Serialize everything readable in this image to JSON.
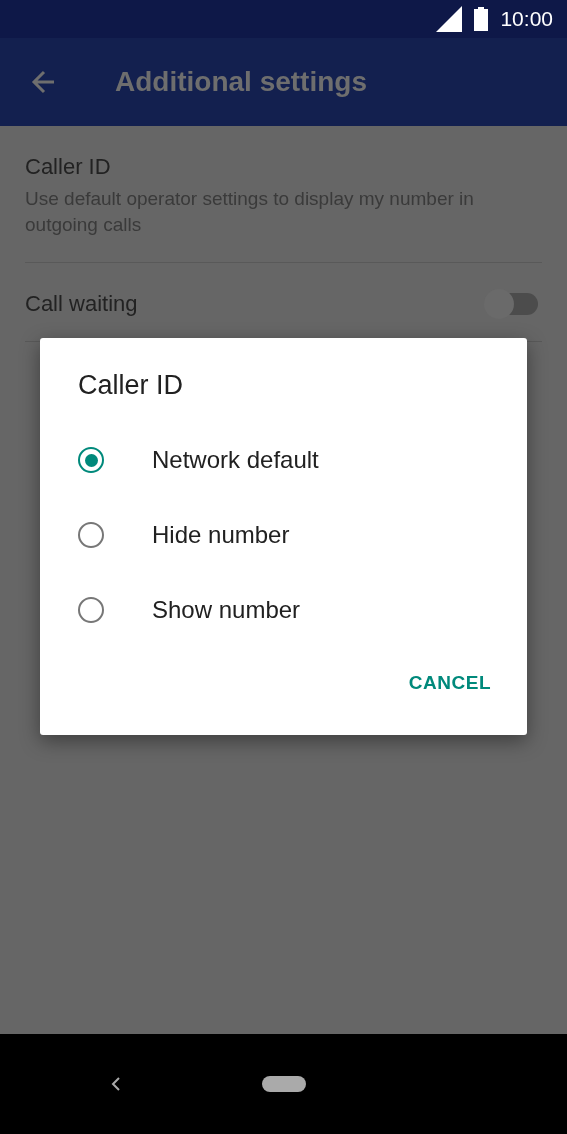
{
  "status_bar": {
    "time": "10:00"
  },
  "app_bar": {
    "title": "Additional settings"
  },
  "settings": [
    {
      "title": "Caller ID",
      "subtitle": "Use default operator settings to display my number in outgoing calls",
      "kind": "text"
    },
    {
      "title": "Call waiting",
      "kind": "switch",
      "on": false
    }
  ],
  "dialog": {
    "title": "Caller ID",
    "options": [
      {
        "label": "Network default",
        "selected": true
      },
      {
        "label": "Hide number",
        "selected": false
      },
      {
        "label": "Show number",
        "selected": false
      }
    ],
    "buttons": [
      "CANCEL"
    ]
  }
}
